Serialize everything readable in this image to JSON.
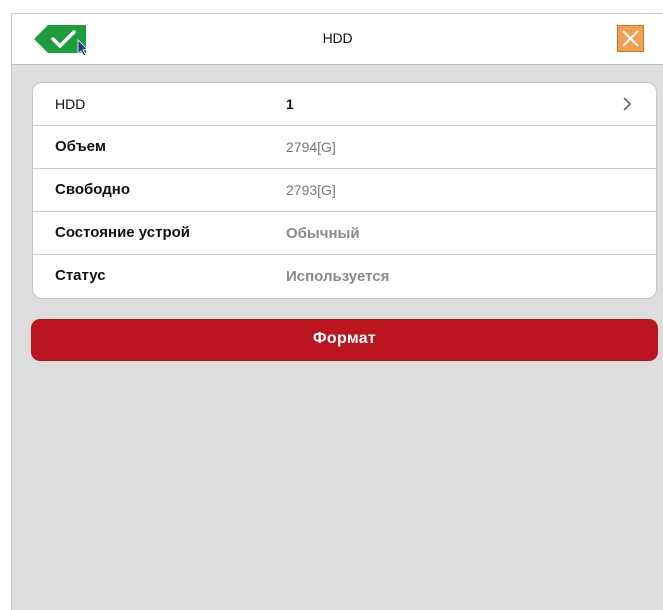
{
  "window": {
    "title": "HDD"
  },
  "icons": {
    "apply": "check-apply-icon",
    "close": "close-icon",
    "chevron": "chevron-right-icon"
  },
  "colors": {
    "close_button": "#f0a050",
    "apply_button": "#1f9c3c",
    "format_button": "#bb1620",
    "panel_background": "#dddddd"
  },
  "disk_info": {
    "rows": [
      {
        "label": "HDD",
        "value": "1"
      },
      {
        "label": "Объем",
        "value": "2794[G]"
      },
      {
        "label": "Свободно",
        "value": "2793[G]"
      },
      {
        "label": "Состояние устрой",
        "value": "Обычный"
      },
      {
        "label": "Статус",
        "value": "Используется"
      }
    ]
  },
  "actions": {
    "format_label": "Формат"
  }
}
